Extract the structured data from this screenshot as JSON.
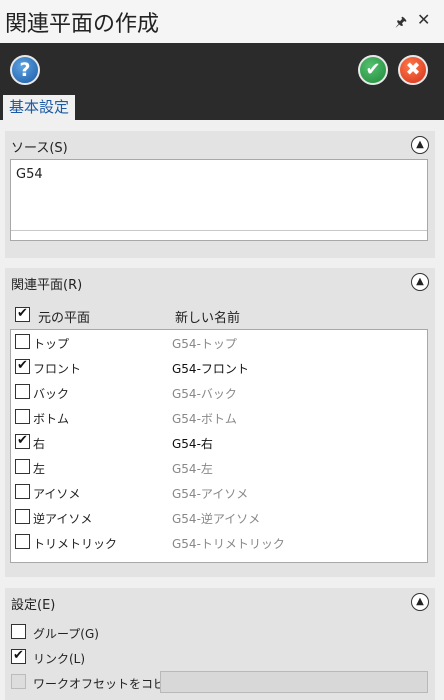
{
  "window": {
    "title": "関連平面の作成"
  },
  "toolbar": {
    "tab_label": "基本設定"
  },
  "source": {
    "title": "ソース(S)",
    "items": [
      "G54"
    ]
  },
  "planes": {
    "title": "関連平面(R)",
    "col1": "元の平面",
    "col2": "新しい名前",
    "header_checked": true,
    "rows": [
      {
        "name": "トップ",
        "new_name": "G54-トップ",
        "checked": false
      },
      {
        "name": "フロント",
        "new_name": "G54-フロント",
        "checked": true
      },
      {
        "name": "バック",
        "new_name": "G54-バック",
        "checked": false
      },
      {
        "name": "ボトム",
        "new_name": "G54-ボトム",
        "checked": false
      },
      {
        "name": "右",
        "new_name": "G54-右",
        "checked": true
      },
      {
        "name": "左",
        "new_name": "G54-左",
        "checked": false
      },
      {
        "name": "アイソメ",
        "new_name": "G54-アイソメ",
        "checked": false
      },
      {
        "name": "逆アイソメ",
        "new_name": "G54-逆アイソメ",
        "checked": false
      },
      {
        "name": "トリメトリック",
        "new_name": "G54-トリメトリック",
        "checked": false
      }
    ]
  },
  "settings": {
    "title": "設定(E)",
    "group_label": "グループ(G)",
    "group_checked": false,
    "link_label": "リンク(L)",
    "link_checked": true,
    "copy_offset_label": "ワークオフセットをコピー(C)",
    "copy_offset_checked": false,
    "copy_offset_value": ""
  }
}
